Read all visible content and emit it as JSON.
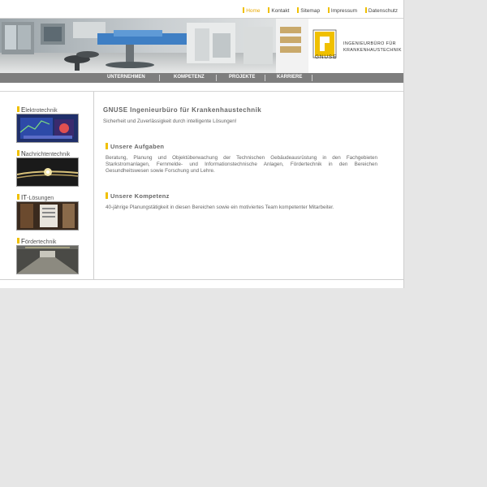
{
  "top_links": [
    {
      "label": "Home",
      "active": true
    },
    {
      "label": "Kontakt",
      "active": false
    },
    {
      "label": "Sitemap",
      "active": false
    },
    {
      "label": "Impressum",
      "active": false
    },
    {
      "label": "Datenschutz",
      "active": false
    }
  ],
  "logo": {
    "mark_text": "GNUSE",
    "line1": "INGENIEURBÜRO FÜR",
    "line2": "KRANKENHAUSTECHNIK"
  },
  "nav": [
    {
      "label": "UNTERNEHMEN"
    },
    {
      "label": "KOMPETENZ"
    },
    {
      "label": "PROJEKTE"
    },
    {
      "label": "KARRIERE"
    }
  ],
  "categories": [
    {
      "initial": "E",
      "rest": "lektrotechnik"
    },
    {
      "initial": "N",
      "rest": "achrichtentechnik"
    },
    {
      "initial": "IT",
      "rest": "-Lösungen"
    },
    {
      "initial": "F",
      "rest": "ördertechnik"
    }
  ],
  "main": {
    "title": "GNUSE Ingenieurbüro für Krankenhaustechnik",
    "tagline": "Sicherheit und Zuverlässigkeit durch intelligente Lösungen!",
    "section1_title": "Unsere Aufgaben",
    "section1_text": "Beratung, Planung und Objektüberwachung der Technischen Gebäudeausrüstung in den Fachgebieten Starkstromanlagen, Fernmelde- und Informationstechnische Anlagen, Fördertechnik in den Bereichen Gesundheitswesen sowie Forschung und Lehre.",
    "section2_title": "Unsere Kompetenz",
    "section2_text": "40-jährige Planungstätigkeit in diesen Bereichen sowie ein motiviertes Team kompetenter Mitarbeiter."
  },
  "colors": {
    "accent": "#f0c000",
    "nav_bg": "#7e7e7e",
    "page_bg": "#e6e6e6"
  }
}
